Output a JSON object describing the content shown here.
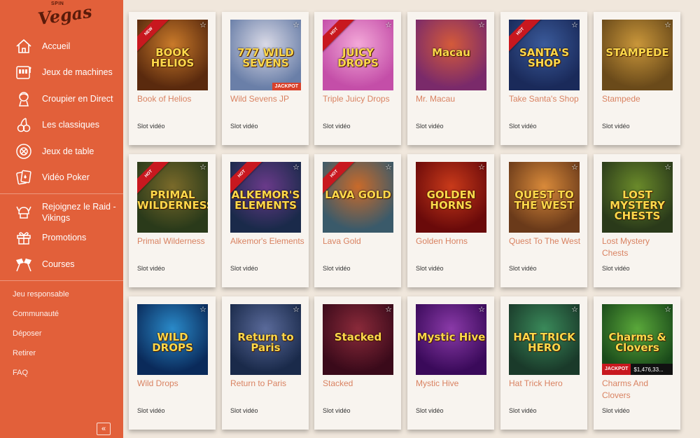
{
  "logo": {
    "small": "SPIN",
    "big": "Vegas"
  },
  "sidebar": {
    "nav": [
      {
        "label": "Accueil",
        "icon": "home-icon"
      },
      {
        "label": "Jeux de machines",
        "icon": "slot-machine-icon"
      },
      {
        "label": "Croupier en Direct",
        "icon": "dealer-icon"
      },
      {
        "label": "Les classiques",
        "icon": "cherries-icon"
      },
      {
        "label": "Jeux de table",
        "icon": "chip-icon"
      },
      {
        "label": "Vidéo Poker",
        "icon": "cards-icon"
      }
    ],
    "promo": [
      {
        "label": "Rejoignez le Raid - Vikings",
        "icon": "viking-helmet-icon"
      },
      {
        "label": "Promotions",
        "icon": "gift-icon"
      },
      {
        "label": "Courses",
        "icon": "race-flags-icon"
      }
    ],
    "links": [
      "Jeu responsable",
      "Communauté",
      "Déposer",
      "Retirer",
      "FAQ"
    ],
    "collapse_label": "«"
  },
  "games": [
    {
      "title": "Book of Helios",
      "category": "Slot vidéo",
      "badge": "NEW",
      "art": "BOOK HELIOS",
      "colors": [
        "#5a2a0e",
        "#c97a2a"
      ]
    },
    {
      "title": "Wild Sevens JP",
      "category": "Slot vidéo",
      "badge": "",
      "jackpot": "JACKPOT",
      "art": "777 WILD SEVENS",
      "colors": [
        "#6a7fa8",
        "#d9d9e6"
      ]
    },
    {
      "title": "Triple Juicy Drops",
      "category": "Slot vidéo",
      "badge": "HOT",
      "art": "JUICY DROPS",
      "colors": [
        "#c44ea8",
        "#f3a8d8"
      ]
    },
    {
      "title": "Mr. Macau",
      "category": "Slot vidéo",
      "badge": "",
      "art": "Macau",
      "colors": [
        "#7a2a6a",
        "#d45a3a"
      ]
    },
    {
      "title": "Take Santa's Shop",
      "category": "Slot vidéo",
      "badge": "HOT",
      "art": "SANTA'S SHOP",
      "colors": [
        "#1a2a5a",
        "#3a5a9a"
      ]
    },
    {
      "title": "Stampede",
      "category": "Slot vidéo",
      "badge": "",
      "art": "STAMPEDE",
      "colors": [
        "#6a4a1a",
        "#c9963a"
      ]
    },
    {
      "title": "Primal Wilderness",
      "category": "Slot vidéo",
      "badge": "HOT",
      "art": "PRIMAL WILDERNESS",
      "colors": [
        "#2a3a1a",
        "#7a6a2a"
      ]
    },
    {
      "title": "Alkemor's Elements",
      "category": "Slot vidéo",
      "badge": "HOT",
      "art": "ALKEMOR'S ELEMENTS",
      "colors": [
        "#1a2a4a",
        "#6a3a8a"
      ]
    },
    {
      "title": "Lava Gold",
      "category": "Slot vidéo",
      "badge": "HOT",
      "art": "LAVA GOLD",
      "colors": [
        "#3a5a6a",
        "#c96a2a"
      ]
    },
    {
      "title": "Golden Horns",
      "category": "Slot vidéo",
      "badge": "",
      "art": "GOLDEN HORNS",
      "colors": [
        "#6a0a0a",
        "#c93a1a"
      ]
    },
    {
      "title": "Quest To The West",
      "category": "Slot vidéo",
      "badge": "",
      "art": "QUEST TO THE WEST",
      "colors": [
        "#6a3a1a",
        "#d98a3a"
      ]
    },
    {
      "title": "Lost Mystery Chests",
      "category": "Slot vidéo",
      "badge": "",
      "art": "LOST MYSTERY CHESTS",
      "colors": [
        "#2a3a1a",
        "#6a8a2a"
      ]
    },
    {
      "title": "Wild Drops",
      "category": "Slot vidéo",
      "badge": "",
      "art": "WILD DROPS",
      "colors": [
        "#0a2a5a",
        "#2a8ac9"
      ]
    },
    {
      "title": "Return to Paris",
      "category": "Slot vidéo",
      "badge": "",
      "art": "Return to Paris",
      "colors": [
        "#1a2a4a",
        "#5a6a9a"
      ]
    },
    {
      "title": "Stacked",
      "category": "Slot vidéo",
      "badge": "",
      "art": "Stacked",
      "colors": [
        "#3a0a1a",
        "#8a2a3a"
      ]
    },
    {
      "title": "Mystic Hive",
      "category": "Slot vidéo",
      "badge": "",
      "art": "Mystic Hive",
      "colors": [
        "#3a0a5a",
        "#8a3aa8"
      ]
    },
    {
      "title": "Hat Trick Hero",
      "category": "Slot vidéo",
      "badge": "",
      "art": "HAT TRICK HERO",
      "colors": [
        "#1a3a2a",
        "#3a8a5a"
      ]
    },
    {
      "title": "Charms And Clovers",
      "category": "Slot vidéo",
      "badge": "",
      "jackpot_bar": {
        "tag": "JACKPOT",
        "amount": "$1,476,33..."
      },
      "art": "Charms & Clovers",
      "colors": [
        "#1a4a1a",
        "#5aa83a"
      ]
    }
  ]
}
